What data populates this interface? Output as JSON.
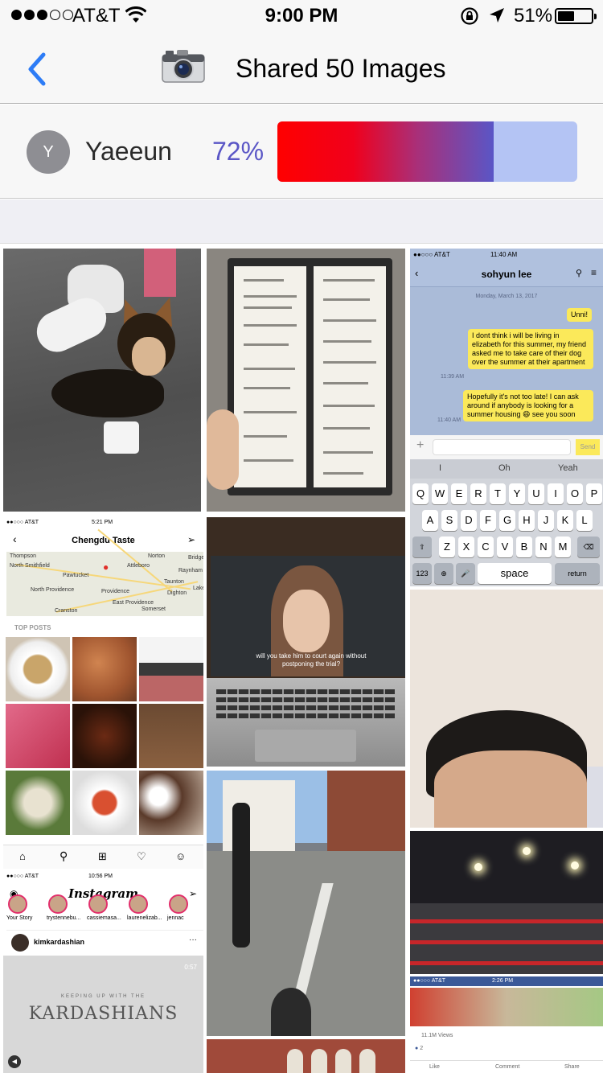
{
  "status_bar": {
    "carrier": "AT&T",
    "time": "9:00 PM",
    "battery": "51%",
    "battery_level": 0.51,
    "signal_bars": 3
  },
  "nav": {
    "title": "Shared 50 Images",
    "back_icon": "chevron-left-icon",
    "camera_icon": "camera-icon"
  },
  "user": {
    "avatar_initial": "Y",
    "name": "Yaeeun",
    "percent_label": "72%",
    "percent": 0.72
  },
  "colors": {
    "accent": "#5a56c6",
    "progress_start": "#ff0000",
    "progress_end": "#5a56c6",
    "progress_track": "#b4c4f4",
    "back_blue": "#2d7cf6"
  },
  "photos": {
    "chat": {
      "status_carrier": "●●○○○ AT&T",
      "status_time": "11:40 AM",
      "contact": "sohyun lee",
      "date": "Monday, March 13, 2017",
      "messages": [
        {
          "text": "Unni!",
          "time": ""
        },
        {
          "text": "I dont think i will be living in elizabeth for this summer, my friend asked me to take care of their dog over the summer at their apartment",
          "time": "11:39 AM"
        },
        {
          "text": "Hopefully it's not too late! I can ask around if anybody is looking for a summer housing 😄 see you soon",
          "time": "11:40 AM"
        }
      ],
      "send": "Send",
      "suggestions": [
        "I",
        "Oh",
        "Yeah"
      ],
      "keys_row1": [
        "Q",
        "W",
        "E",
        "R",
        "T",
        "Y",
        "U",
        "I",
        "O",
        "P"
      ],
      "keys_row2": [
        "A",
        "S",
        "D",
        "F",
        "G",
        "H",
        "J",
        "K",
        "L"
      ],
      "keys_row3": [
        "Z",
        "X",
        "C",
        "V",
        "B",
        "N",
        "M"
      ],
      "key_123": "123",
      "key_space": "space",
      "key_return": "return"
    },
    "chengdu": {
      "status_carrier": "●●○○○ AT&T",
      "status_time": "5:21 PM",
      "title": "Chengdu Taste",
      "map_labels": [
        "Thompson",
        "North Smithfield",
        "Attleboro",
        "Norton",
        "Pawtucket",
        "Providence",
        "Taunton",
        "North Providence",
        "East Providence",
        "Cranston",
        "Somerset",
        "Dighton",
        "Raynham",
        "Bridge",
        "Lake"
      ],
      "top_posts": "TOP POSTS"
    },
    "tv": {
      "subtitle": "will you take him to court again without postponing the trial?"
    },
    "instagram": {
      "status_carrier": "●●○○○ AT&T",
      "status_time": "10:56 PM",
      "logo": "Instagram",
      "stories": [
        "Your Story",
        "trystennebu...",
        "cassiemasa...",
        "laurenelizab...",
        "jennac"
      ],
      "post_user": "kimkardashian",
      "video_time": "0:57",
      "show_small": "KEEPING UP WITH THE",
      "show_title": "KARDASHIANS"
    },
    "facebook": {
      "status_carrier": "●●○○○ AT&T",
      "status_time": "2:26 PM",
      "views": "11.1M Views",
      "reactions": "2",
      "like": "Like",
      "comment": "Comment",
      "share": "Share"
    }
  }
}
